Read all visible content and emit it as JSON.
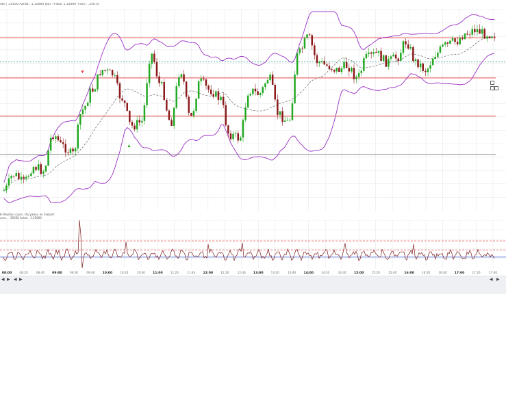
{
  "info": {
    "line1": "nts  |  ,35050 Achat  ,  1,35060  Jour  :+4sur  1,35060  +Sec  :  ,35075",
    "line2": "8  (Position courn. Oscyateur  en  mabzef",
    "line3": "ures.  ,  ,35050 Achat  ,  1,35060"
  },
  "colors": {
    "grid": "#e6e8eb",
    "bull": "#22a822",
    "bear": "#8b1a1a",
    "band": "#9a2dc4",
    "mid": "#666666",
    "hline_red": "#ee3333",
    "hline_gray": "#888888",
    "hline_teal": "#2a9a8a",
    "osc_line": "#7a1a1a",
    "osc_ref_blue": "#3355cc",
    "arrow_red": "#ee3333",
    "arrow_green": "#22a822"
  },
  "chart_data": [
    {
      "type": "candlestick",
      "indicators": [
        "bollinger_bands",
        "dashed_midline"
      ],
      "x_start": "08:35",
      "x_end": "17:40",
      "y_range": [
        0,
        100
      ],
      "hlines": [
        {
          "value": 0.14,
          "style": "solid",
          "color": "#ee3333"
        },
        {
          "value": 0.26,
          "style": "dashed",
          "color": "#2a9a8a"
        },
        {
          "value": 0.34,
          "style": "solid",
          "color": "#ee3333"
        },
        {
          "value": 0.53,
          "style": "solid",
          "color": "#ee3333"
        },
        {
          "value": 0.72,
          "style": "solid",
          "color": "#888888"
        }
      ],
      "price_path": [
        [
          0.0,
          0.9
        ],
        [
          0.02,
          0.82
        ],
        [
          0.04,
          0.86
        ],
        [
          0.06,
          0.78
        ],
        [
          0.08,
          0.8
        ],
        [
          0.1,
          0.62
        ],
        [
          0.12,
          0.68
        ],
        [
          0.14,
          0.72
        ],
        [
          0.16,
          0.5
        ],
        [
          0.18,
          0.4
        ],
        [
          0.2,
          0.3
        ],
        [
          0.22,
          0.32
        ],
        [
          0.24,
          0.44
        ],
        [
          0.26,
          0.58
        ],
        [
          0.28,
          0.56
        ],
        [
          0.3,
          0.22
        ],
        [
          0.32,
          0.38
        ],
        [
          0.34,
          0.56
        ],
        [
          0.36,
          0.3
        ],
        [
          0.38,
          0.54
        ],
        [
          0.4,
          0.36
        ],
        [
          0.42,
          0.4
        ],
        [
          0.44,
          0.44
        ],
        [
          0.46,
          0.62
        ],
        [
          0.48,
          0.64
        ],
        [
          0.5,
          0.4
        ],
        [
          0.52,
          0.42
        ],
        [
          0.54,
          0.34
        ],
        [
          0.56,
          0.52
        ],
        [
          0.58,
          0.56
        ],
        [
          0.6,
          0.22
        ],
        [
          0.62,
          0.14
        ],
        [
          0.64,
          0.26
        ],
        [
          0.66,
          0.28
        ],
        [
          0.68,
          0.3
        ],
        [
          0.7,
          0.28
        ],
        [
          0.72,
          0.34
        ],
        [
          0.74,
          0.24
        ],
        [
          0.76,
          0.22
        ],
        [
          0.78,
          0.26
        ],
        [
          0.8,
          0.24
        ],
        [
          0.82,
          0.16
        ],
        [
          0.84,
          0.26
        ],
        [
          0.86,
          0.3
        ],
        [
          0.88,
          0.22
        ],
        [
          0.9,
          0.18
        ],
        [
          0.92,
          0.16
        ],
        [
          0.94,
          0.12
        ],
        [
          0.96,
          0.1
        ],
        [
          0.98,
          0.12
        ]
      ],
      "arrows": [
        {
          "x": 0.163,
          "y": 0.34,
          "dir": "down",
          "color": "#ee3333"
        },
        {
          "x": 0.255,
          "y": 0.68,
          "dir": "up",
          "color": "#22a822"
        }
      ]
    },
    {
      "type": "line",
      "name": "oscillator",
      "x_start": "08:35",
      "x_end": "17:40",
      "y_range": [
        0,
        100
      ],
      "hlines": [
        {
          "value": 0.43,
          "style": "dashed",
          "color": "#ee3333"
        },
        {
          "value": 0.62,
          "style": "dashed",
          "color": "#ee3333"
        },
        {
          "value": 0.77,
          "style": "solid",
          "color": "#3355cc"
        }
      ],
      "baseline": 0.72
    }
  ],
  "time_axis": [
    {
      "label": "08:00",
      "major": true
    },
    {
      "label": "08:20",
      "major": false
    },
    {
      "label": "08:40",
      "major": false
    },
    {
      "label": "09:00",
      "major": true
    },
    {
      "label": "09:20",
      "major": false
    },
    {
      "label": "09:40",
      "major": false
    },
    {
      "label": "10:00",
      "major": true
    },
    {
      "label": "10:20",
      "major": false
    },
    {
      "label": "10:40",
      "major": false
    },
    {
      "label": "11:00",
      "major": true
    },
    {
      "label": "11:20",
      "major": false
    },
    {
      "label": "11:40",
      "major": false
    },
    {
      "label": "12:00",
      "major": true
    },
    {
      "label": "12:20",
      "major": false
    },
    {
      "label": "12:40",
      "major": false
    },
    {
      "label": "13:00",
      "major": true
    },
    {
      "label": "13:20",
      "major": false
    },
    {
      "label": "13:40",
      "major": false
    },
    {
      "label": "14:00",
      "major": true
    },
    {
      "label": "14:20",
      "major": false
    },
    {
      "label": "14:40",
      "major": false
    },
    {
      "label": "15:00",
      "major": true
    },
    {
      "label": "15:20",
      "major": false
    },
    {
      "label": "15:40",
      "major": false
    },
    {
      "label": "16:00",
      "major": true
    },
    {
      "label": "16:20",
      "major": false
    },
    {
      "label": "16:40",
      "major": false
    },
    {
      "label": "17:00",
      "major": true
    },
    {
      "label": "17:20",
      "major": false
    },
    {
      "label": "17:40",
      "major": false
    }
  ],
  "nav": {
    "left_buttons": [
      "◀",
      "▶",
      "◀",
      "▶"
    ],
    "right_buttons": [
      "◀",
      "▶"
    ]
  }
}
